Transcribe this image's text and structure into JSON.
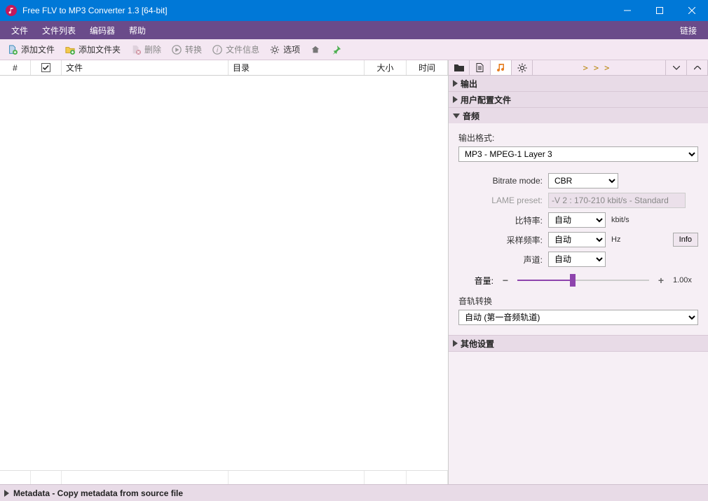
{
  "window": {
    "title": "Free FLV to MP3 Converter 1.3  [64-bit]"
  },
  "menu": {
    "file": "文件",
    "file_list": "文件列表",
    "encoder": "编码器",
    "help": "帮助",
    "link": "链接"
  },
  "toolbar": {
    "add_file": "添加文件",
    "add_folder": "添加文件夹",
    "delete": "删除",
    "convert": "转换",
    "file_info": "文件信息",
    "options": "选项"
  },
  "table": {
    "col_num": "#",
    "col_file": "文件",
    "col_dir": "目录",
    "col_size": "大小",
    "col_time": "时间"
  },
  "panel": {
    "output": "输出",
    "user_profile": "用户配置文件",
    "audio": "音频",
    "other_settings": "其他设置",
    "more": ">>>"
  },
  "audio": {
    "output_format_label": "输出格式:",
    "output_format_value": "MP3 - MPEG-1 Layer 3",
    "bitrate_mode_label": "Bitrate mode:",
    "bitrate_mode_value": "CBR",
    "lame_preset_label": "LAME preset:",
    "lame_preset_value": "-V 2 : 170-210 kbit/s - Standard",
    "bitrate_label": "比特率:",
    "bitrate_value": "自动",
    "bitrate_unit": "kbit/s",
    "samplerate_label": "采样频率:",
    "samplerate_value": "自动",
    "samplerate_unit": "Hz",
    "channel_label": "声道:",
    "channel_value": "自动",
    "info_button": "Info",
    "volume_label": "音量:",
    "volume_value": "1.00x",
    "track_convert_label": "音轨转换",
    "track_convert_value": "自动 (第一音频轨道)"
  },
  "footer": {
    "text": "Metadata - Copy metadata from source file"
  }
}
